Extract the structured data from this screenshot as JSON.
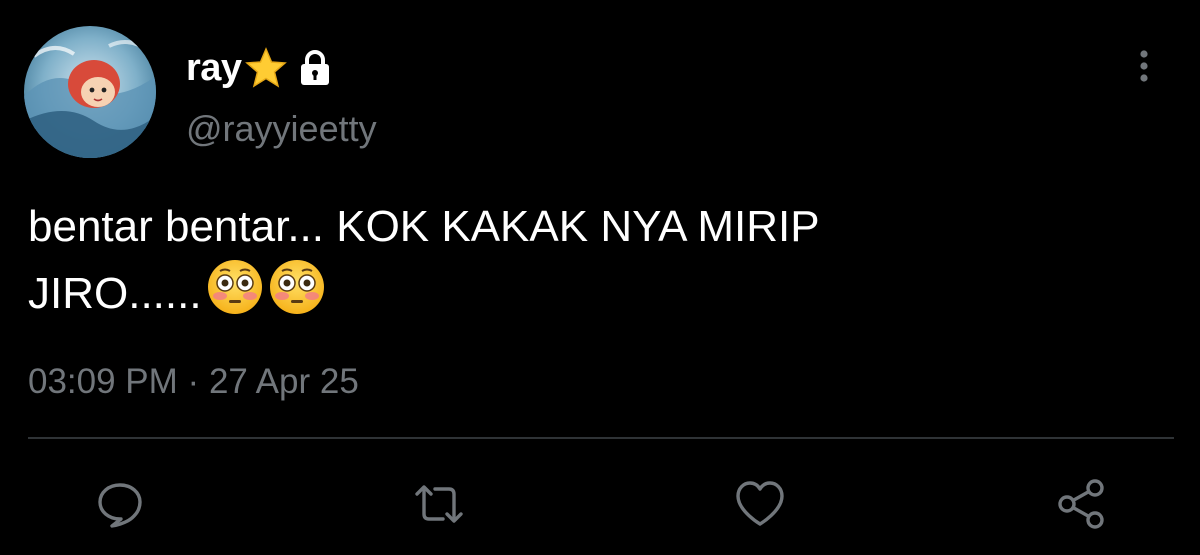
{
  "tweet": {
    "author": {
      "display_name": "ray",
      "handle": "@rayyieetty",
      "badges": [
        "star-emoji",
        "lock-icon"
      ]
    },
    "text": {
      "line1": "bentar bentar... KOK KAKAK NYA MIRIP",
      "line2": "JIRO......",
      "emojis": [
        "flushed-face",
        "flushed-face"
      ]
    },
    "time": "03:09 PM",
    "separator": "·",
    "date": "27 Apr 25"
  },
  "actions": [
    {
      "name": "reply",
      "icon": "speech-bubble-icon"
    },
    {
      "name": "retweet",
      "icon": "retweet-icon"
    },
    {
      "name": "like",
      "icon": "heart-icon"
    },
    {
      "name": "share",
      "icon": "share-icon"
    }
  ],
  "colors": {
    "background": "#000000",
    "text_primary": "#ffffff",
    "text_secondary": "#71767b",
    "divider": "#2f3336"
  }
}
